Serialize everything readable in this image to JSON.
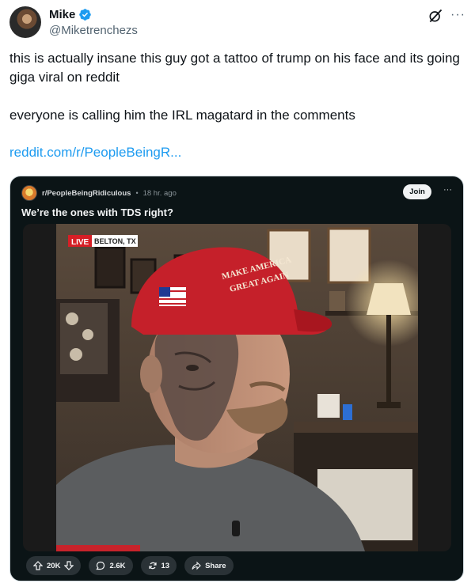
{
  "author": {
    "display_name": "Mike",
    "handle": "@Miketrenchezs"
  },
  "icons": {
    "verified": "verified-badge-icon",
    "grok": "grok-icon",
    "more": "more-icon"
  },
  "colors": {
    "link": "#1d9bf0",
    "verified": "#1d9bf0",
    "handle_gray": "#536471",
    "card_bg": "#0b1416"
  },
  "tweet": {
    "paragraph_1": "this is actually insane this guy got a tattoo of trump on his face and its going giga viral on reddit",
    "paragraph_2": "everyone is calling him the IRL magatard in the comments",
    "link_text": "reddit.com/r/PeopleBeingR..."
  },
  "card": {
    "subreddit": "r/PeopleBeingRidiculous",
    "separator": "•",
    "time": "18 hr. ago",
    "join_label": "Join",
    "more_label": "···",
    "title": "We’re the ones with TDS right?",
    "video": {
      "live_badge": "LIVE",
      "location": "BELTON, TX",
      "hat_text_1": "MAKE AMERICA",
      "hat_text_2": "GREAT AGAIN"
    },
    "actions": {
      "upvotes": "20K",
      "comments": "2.6K",
      "shares_count": "13",
      "share_label": "Share"
    }
  }
}
